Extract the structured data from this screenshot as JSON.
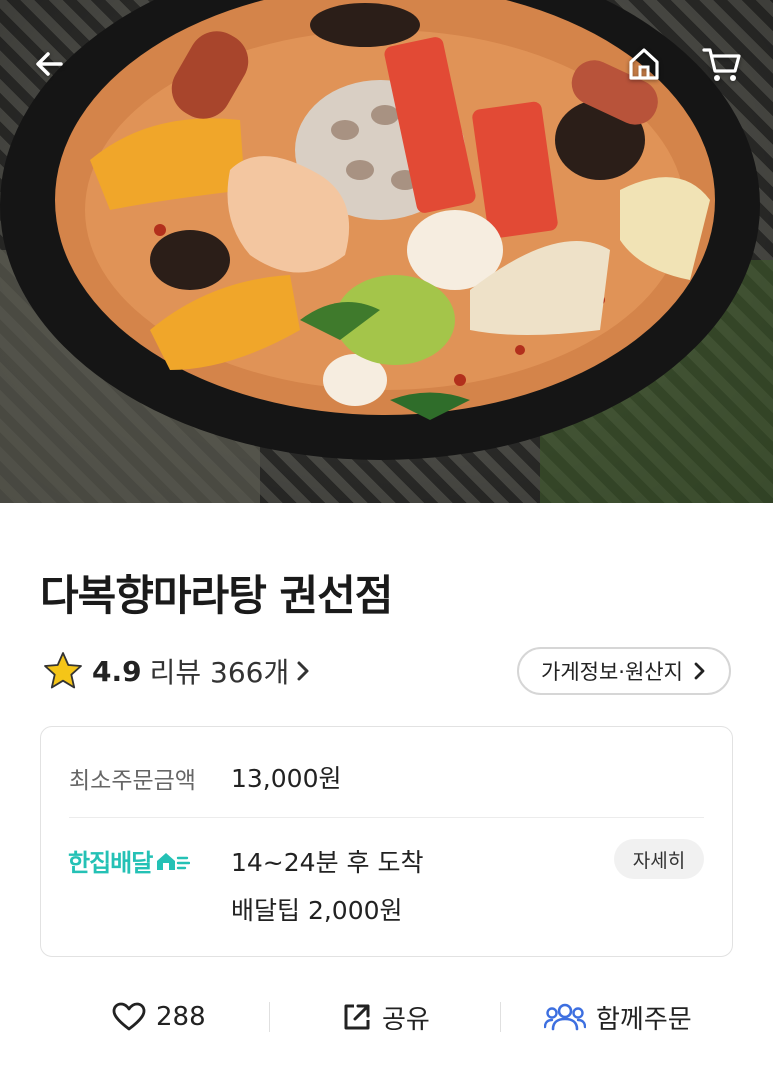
{
  "nav": {
    "back_icon": "arrow-left-icon",
    "home_icon": "home-icon",
    "cart_icon": "cart-icon"
  },
  "hero": {
    "image": "mala-tang-bowl-photo"
  },
  "store": {
    "name": "다복향마라탕 권선점",
    "rating": "4.9",
    "review_label": "리뷰 366개",
    "info_button": "가게정보·원산지"
  },
  "delivery": {
    "min_order_label": "최소주문금액",
    "min_order_value": "13,000원",
    "brand": "한집배달",
    "eta": "14~24분 후 도착",
    "tip": "배달팁 2,000원",
    "detail_button": "자세히"
  },
  "actions": {
    "like_count": "288",
    "share_label": "공유",
    "group_order_label": "함께주문"
  },
  "colors": {
    "brand_teal": "#24c1b5",
    "group_blue": "#3d6fe0",
    "star_gold": "#f5c518"
  }
}
